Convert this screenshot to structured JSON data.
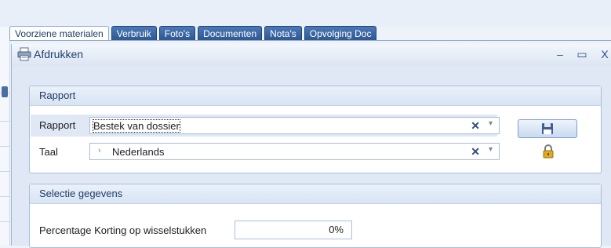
{
  "tabs": [
    {
      "label": "Voorziene materialen"
    },
    {
      "label": "Verbruik"
    },
    {
      "label": "Foto's"
    },
    {
      "label": "Documenten"
    },
    {
      "label": "Nota's"
    },
    {
      "label": "Opvolging Doc"
    }
  ],
  "dialog": {
    "title": "Afdrukken",
    "minimize": "–",
    "maximize": "▭",
    "close": "X"
  },
  "rapport_group": {
    "header": "Rapport",
    "rapport_label": "Rapport",
    "rapport_value": "Bestek van dossier",
    "taal_label": "Taal",
    "taal_value": "Nederlands",
    "clear_glyph": "✕",
    "dropdown_glyph": "▾",
    "expander_glyph": "›"
  },
  "selectie_group": {
    "header": "Selectie gegevens",
    "korting_label": "Percentage Korting op wisselstukken",
    "korting_value": "0%"
  },
  "colors": {
    "tab_blue": "#2d5692",
    "header_text": "#1f3c66",
    "accent_gold": "#d9a520"
  },
  "icons": {
    "title": "printer-icon",
    "save": "floppy-disk-icon",
    "lock": "padlock-icon"
  }
}
